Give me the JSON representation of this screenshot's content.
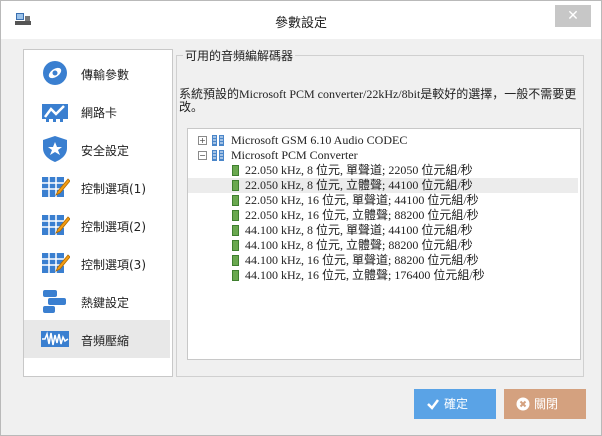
{
  "window": {
    "title": "參數設定",
    "close_glyph": "✕"
  },
  "sidebar": {
    "items": [
      {
        "label": "傳輸參數",
        "icon": "satellite-icon"
      },
      {
        "label": "網路卡",
        "icon": "network-card-icon"
      },
      {
        "label": "安全設定",
        "icon": "shield-star-icon"
      },
      {
        "label": "控制選項(1)",
        "icon": "grid-pencil-icon"
      },
      {
        "label": "控制選項(2)",
        "icon": "grid-pencil-icon"
      },
      {
        "label": "控制選項(3)",
        "icon": "grid-pencil-icon"
      },
      {
        "label": "熱鍵設定",
        "icon": "keys-icon"
      },
      {
        "label": "音頻壓縮",
        "icon": "waveform-icon",
        "active": true
      }
    ]
  },
  "panel": {
    "group_title": "可用的音頻編解碼器",
    "description": "系統預設的Microsoft PCM converter/22kHz/8bit是較好的選擇，一般不需要更改。"
  },
  "tree": {
    "codecs": [
      {
        "label": "Microsoft GSM 6.10 Audio CODEC",
        "expander": "+"
      },
      {
        "label": "Microsoft PCM Converter",
        "expander": "−"
      }
    ],
    "formats": [
      "22.050 kHz, 8 位元, 單聲道; 22050 位元組/秒",
      "22.050 kHz, 8 位元, 立體聲; 44100 位元組/秒",
      "22.050 kHz, 16 位元, 單聲道; 44100 位元組/秒",
      "22.050 kHz, 16 位元, 立體聲; 88200 位元組/秒",
      "44.100 kHz, 8 位元, 單聲道; 44100 位元組/秒",
      "44.100 kHz, 8 位元, 立體聲; 88200 位元組/秒",
      "44.100 kHz, 16 位元, 單聲道; 88200 位元組/秒",
      "44.100 kHz, 16 位元, 立體聲; 176400 位元組/秒"
    ],
    "selected_format": "22.050 kHz, 8 位元, 立體聲; 44100 位元組/秒"
  },
  "buttons": {
    "ok_label": "確定",
    "close_label": "關閉"
  },
  "colors": {
    "ok": "#5aa3e6",
    "close": "#d4a17f",
    "icon_blue": "#3a7fd0"
  }
}
